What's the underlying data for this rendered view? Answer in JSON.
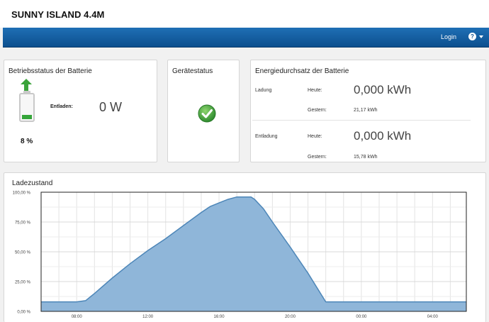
{
  "app": {
    "title": "SUNNY ISLAND 4.4M"
  },
  "navbar": {
    "login_label": "Login",
    "help_icon": "?"
  },
  "battery_status": {
    "title": "Betriebsstatus der Batterie",
    "mode_label": "Entladen:",
    "power": "0 W",
    "charge_percent": "8 %",
    "charge_fraction": 0.08,
    "fill_color": "#35a53a"
  },
  "device_status": {
    "title": "Gerätestatus",
    "status_icon": "ok-check-icon",
    "status_color": "#3aa33a"
  },
  "energy": {
    "title": "Energiedurchsatz der Batterie",
    "charge": {
      "label": "Ladung",
      "today_label": "Heute:",
      "today_value": "0,000 kWh",
      "yesterday_label": "Gestern:",
      "yesterday_value": "21,17 kWh"
    },
    "discharge": {
      "label": "Entladung",
      "today_label": "Heute:",
      "today_value": "0,000 kWh",
      "yesterday_label": "Gestern:",
      "yesterday_value": "15,78 kWh"
    }
  },
  "chart_data": {
    "type": "area",
    "title": "Ladezustand",
    "xlabel": "",
    "ylabel": "",
    "x_tick_labels": [
      "08:00",
      "12:00",
      "16:00",
      "20:00",
      "00:00",
      "04:00"
    ],
    "x_ticks": [
      8,
      12,
      16,
      20,
      24,
      28
    ],
    "xlim": [
      6.0,
      29.9
    ],
    "y_tick_labels": [
      "100,00 %",
      "75,00 %",
      "50,00 %",
      "25,00 %",
      "0,00 %"
    ],
    "y_ticks": [
      100,
      75,
      50,
      25,
      0
    ],
    "ylim": [
      0,
      100
    ],
    "grid": true,
    "fill_color": "#8fb6d9",
    "line_color": "#4d86b8",
    "series": [
      {
        "x": [
          6.0,
          7.0,
          7.5,
          8.0,
          8.5,
          9.0,
          10.0,
          11.0,
          12.0,
          13.0,
          14.0,
          15.0,
          15.5,
          16.0,
          16.5,
          17.0,
          17.8,
          18.0,
          18.5,
          19.0,
          20.0,
          21.0,
          22.0,
          23.0,
          24.0,
          25.0,
          26.0,
          27.0,
          28.0,
          29.0,
          29.9
        ],
        "y": [
          8,
          8,
          8,
          8,
          9,
          15,
          28,
          40,
          51,
          61,
          72,
          83,
          88,
          91,
          94,
          96,
          96,
          94,
          86,
          75,
          54,
          32,
          8,
          8,
          8,
          8,
          8,
          8,
          8,
          8,
          8
        ]
      }
    ]
  }
}
